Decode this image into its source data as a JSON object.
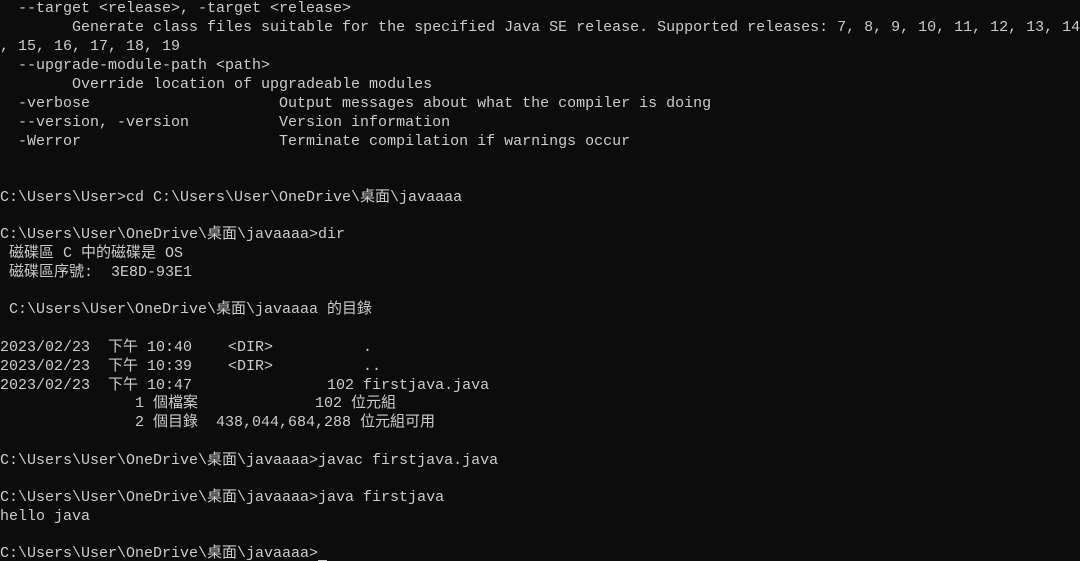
{
  "terminal": {
    "lines": [
      "  --target <release>, -target <release>",
      "        Generate class files suitable for the specified Java SE release. Supported releases: 7, 8, 9, 10, 11, 12, 13, 14",
      ", 15, 16, 17, 18, 19",
      "  --upgrade-module-path <path>",
      "        Override location of upgradeable modules",
      "  -verbose                     Output messages about what the compiler is doing",
      "  --version, -version          Version information",
      "  -Werror                      Terminate compilation if warnings occur",
      "",
      "",
      "C:\\Users\\User>cd C:\\Users\\User\\OneDrive\\桌面\\javaaaa",
      "",
      "C:\\Users\\User\\OneDrive\\桌面\\javaaaa>dir",
      " 磁碟區 C 中的磁碟是 OS",
      " 磁碟區序號:  3E8D-93E1",
      "",
      " C:\\Users\\User\\OneDrive\\桌面\\javaaaa 的目錄",
      "",
      "2023/02/23  下午 10:40    <DIR>          .",
      "2023/02/23  下午 10:39    <DIR>          ..",
      "2023/02/23  下午 10:47               102 firstjava.java",
      "               1 個檔案             102 位元組",
      "               2 個目錄  438,044,684,288 位元組可用",
      "",
      "C:\\Users\\User\\OneDrive\\桌面\\javaaaa>javac firstjava.java",
      "",
      "C:\\Users\\User\\OneDrive\\桌面\\javaaaa>java firstjava",
      "hello java",
      "",
      "C:\\Users\\User\\OneDrive\\桌面\\javaaaa>"
    ]
  }
}
